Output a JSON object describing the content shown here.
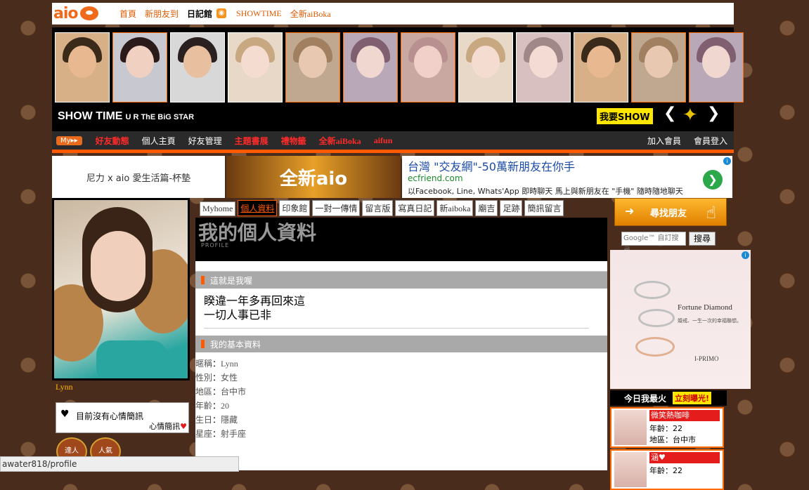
{
  "topnav": {
    "logo": "aio",
    "links": [
      "首頁",
      "新朋友到",
      "日記館",
      "SHOWTIME",
      "全新aiBoka"
    ]
  },
  "showstrip": {
    "title": "SHOW TIME",
    "subtitle": "U R ThE BiG STAR",
    "cta": "我要SHOW",
    "photo_count": 12
  },
  "menubar": {
    "my": "My▸▸",
    "items": [
      "好友動態",
      "個人主頁",
      "好友管理",
      "主題書展",
      "禮物籤",
      "全新aiBoka",
      "aifun"
    ],
    "right": [
      "加入會員",
      "會員登入"
    ]
  },
  "banners": {
    "b1": "尼力 x aio 愛生活篇-杯墊",
    "b2": "全新aio",
    "b3": {
      "headline": "台灣 \"交友網\"-50萬新朋友在你手",
      "url": "ecfriend.com",
      "desc": "以Facebook, Line, Whats'App 即時聊天 馬上與新朋友在 \"手機\" 隨時隨地聊天"
    }
  },
  "profile": {
    "name": "Lynn",
    "mood": "目前沒有心情簡訊",
    "mood_label": "心情簡訊",
    "badges": [
      "達人",
      "人氣"
    ]
  },
  "tabs": [
    "Myhome",
    "個人資料",
    "印象館",
    "一對一傳情",
    "留言版",
    "寫真日記",
    "新aiboka",
    "廟吉",
    "足跡",
    "簡訊留言"
  ],
  "active_tab": "個人資料",
  "page": {
    "heading": "我的個人資料",
    "sub": "PROFILE",
    "section1": "這就是我喔",
    "quote": [
      "睽違一年多再回來這",
      "一切人事已非"
    ],
    "section2": "我的基本資料",
    "info": [
      {
        "k": "暱稱",
        "v": "Lynn"
      },
      {
        "k": "性別",
        "v": "女性"
      },
      {
        "k": "地區",
        "v": "台中市"
      },
      {
        "k": "年齡",
        "v": "20"
      },
      {
        "k": "生日",
        "v": "隱藏"
      },
      {
        "k": "星座",
        "v": "射手座"
      }
    ]
  },
  "right": {
    "find": "尋找朋友",
    "google": "Google™ 自訂搜尋",
    "search_btn": "搜尋",
    "ad": {
      "brand": "Fortune Diamond",
      "tag": "婚戒、一生一次的幸福聯想。",
      "maker": "I-PRIMO"
    },
    "hot_title": "今日我最火",
    "hot_btn": "立刻曝光!",
    "hot": [
      {
        "name": "微笑熱咖啡",
        "age": "年齡：22",
        "city": "地區：台中市"
      },
      {
        "name": "涵♥",
        "age": "年齡：22",
        "city": ""
      }
    ]
  },
  "statusbar": "awater818/profile"
}
